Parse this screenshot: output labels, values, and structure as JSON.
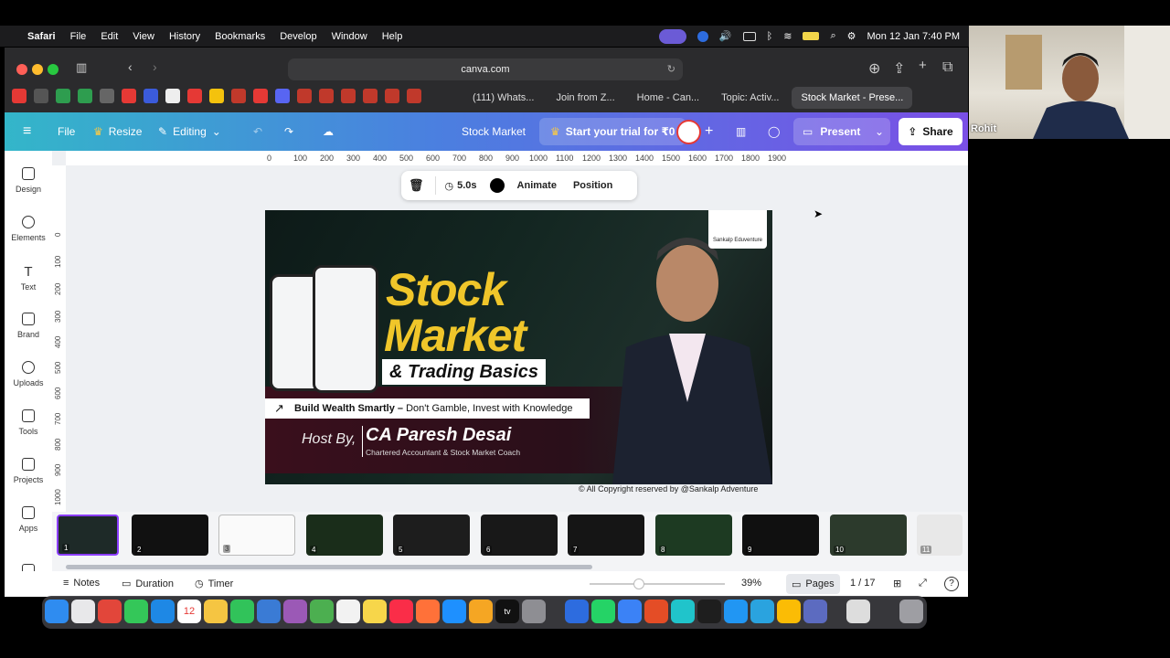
{
  "menubar": {
    "app": "Safari",
    "items": [
      "File",
      "Edit",
      "View",
      "History",
      "Bookmarks",
      "Develop",
      "Window",
      "Help"
    ],
    "datetime": "Mon 12 Jan  7:40 PM"
  },
  "browser": {
    "url": "canva.com",
    "tabs": [
      "(111) Whats...",
      "Join from Z...",
      "Home - Can...",
      "Topic: Activ...",
      "Stock Market - Prese..."
    ]
  },
  "canva": {
    "menu_label": "File",
    "resize_label": "Resize",
    "mode_label": "Editing",
    "doc_title": "Stock Market",
    "trial_label": "Start your trial for ₹0",
    "present_label": "Present",
    "share_label": "Share"
  },
  "sidebar": {
    "items": [
      {
        "label": "Design",
        "icon": "layout-icon"
      },
      {
        "label": "Elements",
        "icon": "shapes-icon"
      },
      {
        "label": "Text",
        "icon": "text-icon"
      },
      {
        "label": "Brand",
        "icon": "brand-icon"
      },
      {
        "label": "Uploads",
        "icon": "cloud-upload-icon"
      },
      {
        "label": "Tools",
        "icon": "pen-icon"
      },
      {
        "label": "Projects",
        "icon": "folder-icon"
      },
      {
        "label": "Apps",
        "icon": "apps-icon"
      }
    ]
  },
  "ruler": {
    "top": [
      "0",
      "100",
      "200",
      "300",
      "400",
      "500",
      "600",
      "700",
      "800",
      "900",
      "1000",
      "1100",
      "1200",
      "1300",
      "1400",
      "1500",
      "1600",
      "1700",
      "1800",
      "1900"
    ],
    "left": [
      "0",
      "100",
      "200",
      "300",
      "400",
      "500",
      "600",
      "700",
      "800",
      "900",
      "1000"
    ]
  },
  "floatbar": {
    "duration": "5.0s",
    "animate": "Animate",
    "position": "Position"
  },
  "slide": {
    "title1": "Stock",
    "title2": "Market",
    "subtitle": "& Trading Basics",
    "tagline_bold": "Build Wealth Smartly – ",
    "tagline": "Don't Gamble, Invest with Knowledge",
    "host": "Host By,",
    "name": "CA Paresh Desai",
    "role": "Chartered Accountant & Stock Market Coach",
    "logo_text": "Sankalp Eduventure",
    "copyright": "All Copyright reserved by @Sankalp Adventure"
  },
  "thumbnails": [
    "1",
    "2",
    "3",
    "4",
    "5",
    "6",
    "7",
    "8",
    "9",
    "10",
    "11"
  ],
  "bottombar": {
    "notes": "Notes",
    "duration": "Duration",
    "timer": "Timer",
    "zoom": "39%",
    "pages": "Pages",
    "page_count": "1 / 17"
  },
  "webcam": {
    "name": "Rohit"
  },
  "colors": {
    "canva_gradient_start": "#33b6c9",
    "canva_gradient_end": "#7a4fe6",
    "title_yellow": "#f0c62a",
    "active_thumb_border": "#8b3dff"
  }
}
